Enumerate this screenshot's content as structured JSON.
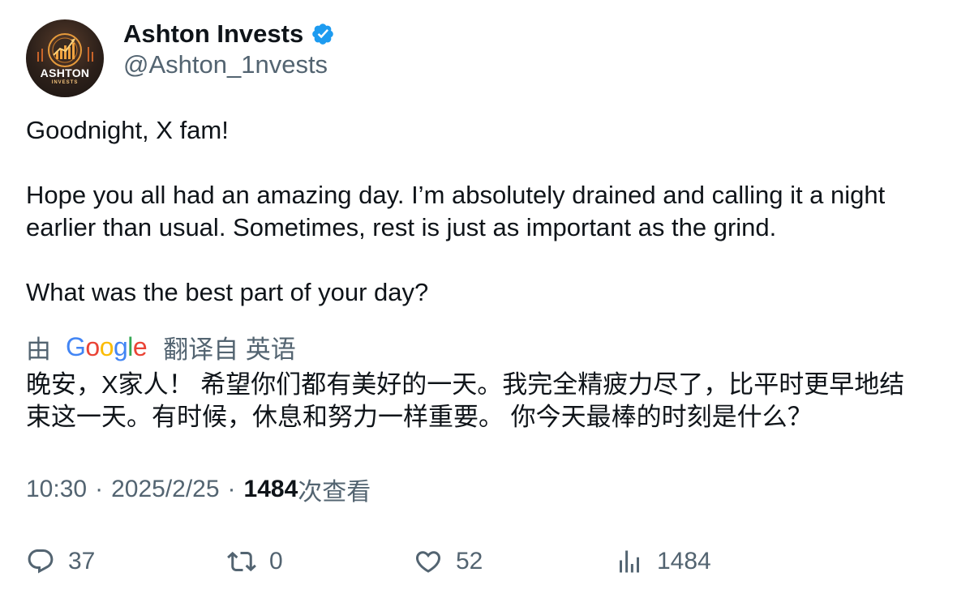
{
  "author": {
    "display_name": "Ashton Invests",
    "handle": "@Ashton_1nvests",
    "avatar_label": "ASHTON",
    "avatar_sublabel": "INVESTS",
    "verified_icon": "verified-badge-icon"
  },
  "tweet": {
    "line1": "Goodnight, X fam!",
    "line2": "Hope you all had an amazing day. I’m absolutely drained and calling it a night",
    "line3": "earlier than usual. Sometimes, rest is just as important as the grind.",
    "line4": "What was the best part of your day?"
  },
  "translation": {
    "by_label": "由",
    "provider": "Google",
    "from_label": "翻译自 英语",
    "line1": "晚安，X家人！ 希望你们都有美好的一天。我完全精疲力尽了，比平时更早地结",
    "line2": "束这一天。有时候，休息和努力一样重要。 你今天最棒的时刻是什么？"
  },
  "meta": {
    "time": "10:30",
    "date": "2025/2/25",
    "views_count": "1484",
    "views_label": "次查看"
  },
  "actions": {
    "replies": "37",
    "reposts": "0",
    "likes": "52",
    "views": "1484"
  },
  "colors": {
    "text": "#0f1419",
    "secondary": "#536471",
    "verified": "#1d9bf0",
    "google_blue": "#4285F4",
    "google_red": "#EA4335",
    "google_yellow": "#FBBC05",
    "google_green": "#34A853"
  }
}
